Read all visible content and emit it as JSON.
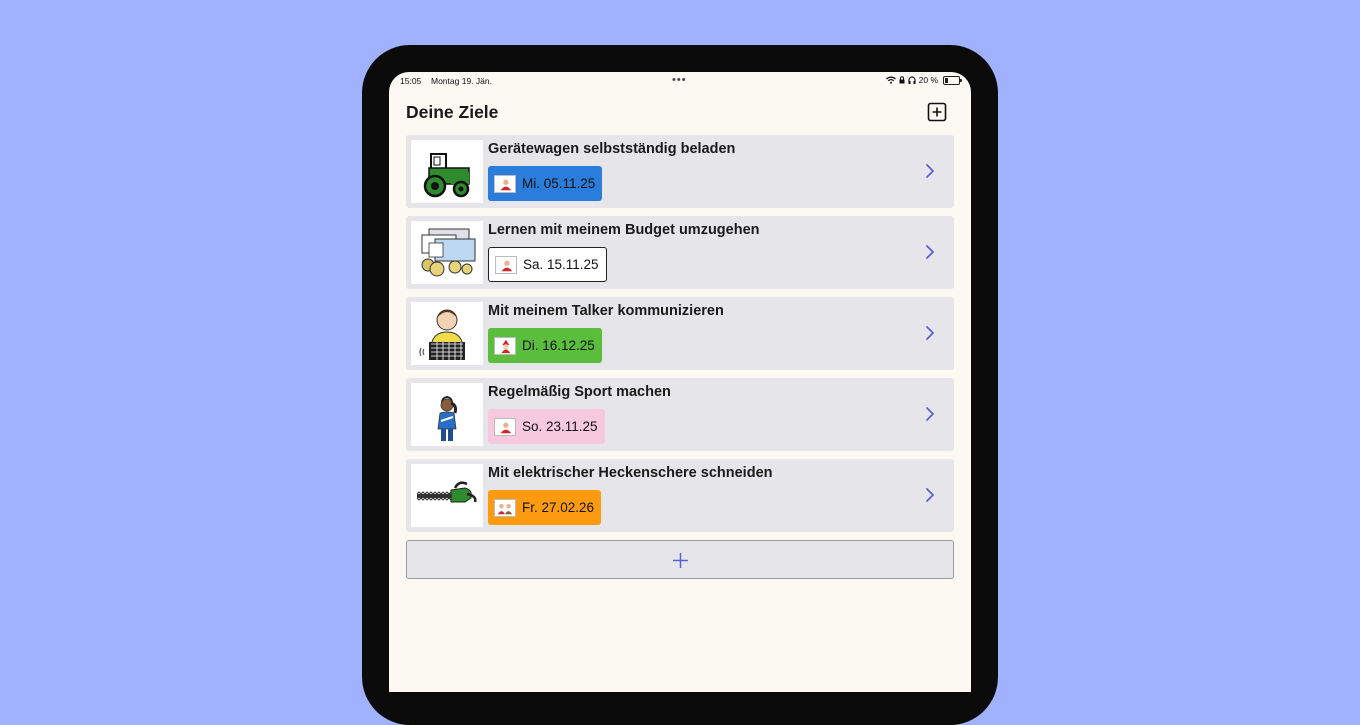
{
  "status_bar": {
    "time": "15:05",
    "date": "Montag 19. Jän.",
    "dots": "•••",
    "battery": "20 %"
  },
  "header": {
    "title": "Deine Ziele",
    "add_icon": "plus-square-icon"
  },
  "goals": [
    {
      "title": "Gerätewagen selbstständig beladen",
      "date": "Mi. 05.11.25",
      "badge_color": "#2a7ddb",
      "picture": "tractor-icon"
    },
    {
      "title": "Lernen mit meinem Budget umzugehen",
      "date": "Sa. 15.11.25",
      "badge_color": "#ffffff",
      "picture": "money-icon"
    },
    {
      "title": "Mit meinem Talker kommunizieren",
      "date": "Di. 16.12.25",
      "badge_color": "#5bbd3c",
      "picture": "talker-person-icon"
    },
    {
      "title": "Regelmäßig Sport machen",
      "date": "So. 23.11.25",
      "badge_color": "#f7c9df",
      "picture": "sport-person-icon"
    },
    {
      "title": "Mit elektrischer Heckenschere schneiden",
      "date": "Fr. 27.02.26",
      "badge_color": "#fc9b0f",
      "picture": "hedge-trimmer-icon"
    }
  ],
  "add_goal_button": {
    "icon": "plus-icon"
  },
  "colors": {
    "background": "#a0b1fd",
    "screen": "#fbf9f2",
    "row": "#e6e6ea",
    "accent": "#5a5fd8"
  }
}
